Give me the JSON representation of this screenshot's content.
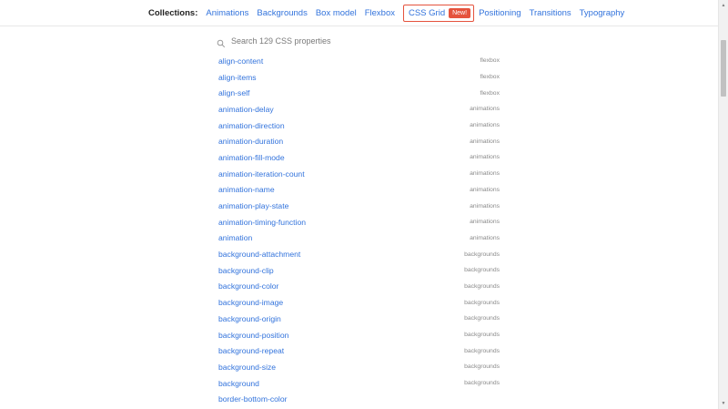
{
  "nav": {
    "label": "Collections:",
    "links": [
      {
        "label": "Animations"
      },
      {
        "label": "Backgrounds"
      },
      {
        "label": "Box model"
      },
      {
        "label": "Flexbox"
      },
      {
        "label": "CSS Grid",
        "badge": "New!",
        "active": true
      },
      {
        "label": "Positioning"
      },
      {
        "label": "Transitions"
      },
      {
        "label": "Typography"
      }
    ]
  },
  "search": {
    "placeholder": "Search 129 CSS properties",
    "value": ""
  },
  "properties": [
    {
      "name": "align-content",
      "category": "flexbox"
    },
    {
      "name": "align-items",
      "category": "flexbox"
    },
    {
      "name": "align-self",
      "category": "flexbox"
    },
    {
      "name": "animation-delay",
      "category": "animations"
    },
    {
      "name": "animation-direction",
      "category": "animations"
    },
    {
      "name": "animation-duration",
      "category": "animations"
    },
    {
      "name": "animation-fill-mode",
      "category": "animations"
    },
    {
      "name": "animation-iteration-count",
      "category": "animations"
    },
    {
      "name": "animation-name",
      "category": "animations"
    },
    {
      "name": "animation-play-state",
      "category": "animations"
    },
    {
      "name": "animation-timing-function",
      "category": "animations"
    },
    {
      "name": "animation",
      "category": "animations"
    },
    {
      "name": "background-attachment",
      "category": "backgrounds"
    },
    {
      "name": "background-clip",
      "category": "backgrounds"
    },
    {
      "name": "background-color",
      "category": "backgrounds"
    },
    {
      "name": "background-image",
      "category": "backgrounds"
    },
    {
      "name": "background-origin",
      "category": "backgrounds"
    },
    {
      "name": "background-position",
      "category": "backgrounds"
    },
    {
      "name": "background-repeat",
      "category": "backgrounds"
    },
    {
      "name": "background-size",
      "category": "backgrounds"
    },
    {
      "name": "background",
      "category": "backgrounds"
    },
    {
      "name": "border-bottom-color",
      "category": ""
    }
  ],
  "colors": {
    "link": "#3273dc",
    "accent": "#e5533d",
    "muted": "#8a8a8a"
  }
}
